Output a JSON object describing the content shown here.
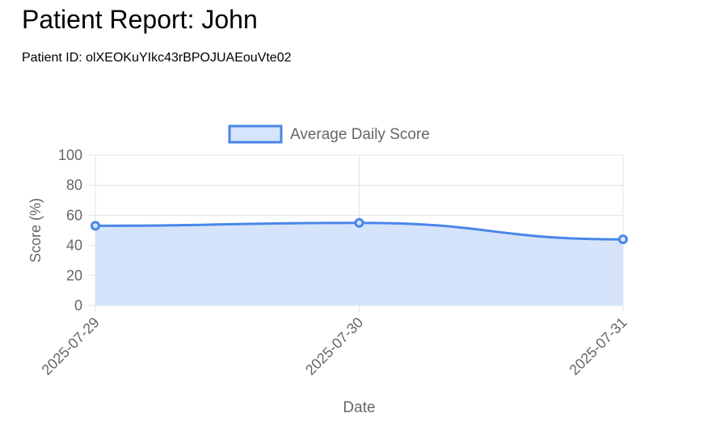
{
  "report": {
    "title": "Patient Report: John",
    "patient_id": "Patient ID: olXEOKuYIkc43rBPOJUAEouVte02"
  },
  "colors": {
    "line": "#4a86e8",
    "fill": "#d6e4fb",
    "grid": "#e3e3e3",
    "axis_text": "#666666"
  },
  "chart_data": {
    "type": "line",
    "x": [
      "2025-07-29",
      "2025-07-30",
      "2025-07-31"
    ],
    "series": [
      {
        "name": "Average Daily Score",
        "values": [
          53,
          55,
          44
        ],
        "fill": true
      }
    ],
    "xlabel": "Date",
    "ylabel": "Score (%)",
    "ylim": [
      0,
      100
    ],
    "yticks": [
      0,
      20,
      40,
      60,
      80,
      100
    ],
    "grid": true,
    "legend": "top-center"
  }
}
